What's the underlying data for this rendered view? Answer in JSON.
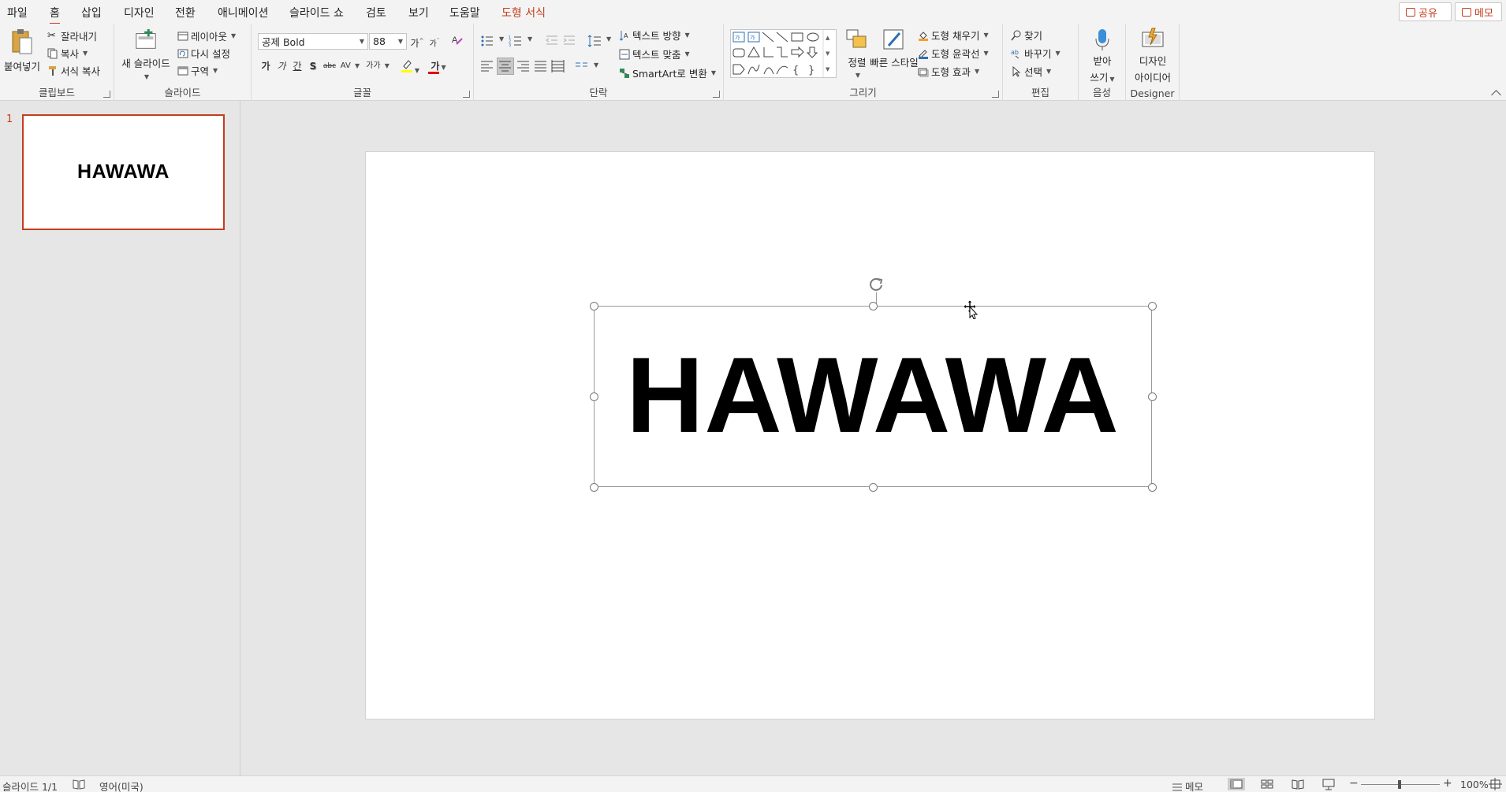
{
  "menu": {
    "tabs": [
      "파일",
      "홈",
      "삽입",
      "디자인",
      "전환",
      "애니메이션",
      "슬라이드 쇼",
      "검토",
      "보기",
      "도움말",
      "도형 서식"
    ],
    "active_tab": "홈",
    "context_tab": "도형 서식",
    "share_label": "공유",
    "comments_label": "메모"
  },
  "ribbon": {
    "clipboard": {
      "label": "클립보드",
      "paste": "붙여넣기",
      "cut": "잘라내기",
      "copy": "복사",
      "format_painter": "서식 복사"
    },
    "slides": {
      "label": "슬라이드",
      "new_slide": "새 슬라이드",
      "layout": "레이아웃",
      "reset": "다시 설정",
      "section": "구역"
    },
    "font": {
      "label": "글꼴",
      "font_name": "공제 Bold",
      "font_size": "88",
      "grow": "가",
      "shrink": "가",
      "bold": "가",
      "italic": "가",
      "underline": "간",
      "shadow": "S",
      "strike": "abc",
      "spacing": "AV",
      "case": "가가",
      "font_color_letter": "가",
      "highlight_color": "#ffff00",
      "font_color": "#e00000"
    },
    "paragraph": {
      "label": "단락",
      "text_direction": "텍스트 방향",
      "align_text": "텍스트 맞춤",
      "smartart": "SmartArt로 변환"
    },
    "drawing": {
      "label": "그리기",
      "arrange": "정렬",
      "quick_styles": "빠른 스타일",
      "shape_fill": "도형 채우기",
      "shape_outline": "도형 윤곽선",
      "shape_effects": "도형 효과"
    },
    "editing": {
      "label": "편집",
      "find": "찾기",
      "replace": "바꾸기",
      "select": "선택"
    },
    "voice": {
      "label": "음성",
      "dictate_line1": "받아",
      "dictate_line2": "쓰기"
    },
    "designer": {
      "label": "Designer",
      "ideas_line1": "디자인",
      "ideas_line2": "아이디어"
    }
  },
  "slides_panel": {
    "slide_number": "1",
    "thumbnail_text": "HAWAWA"
  },
  "slide": {
    "text": "HAWAWA"
  },
  "statusbar": {
    "slide_info": "슬라이드 1/1",
    "language": "영어(미국)",
    "notes": "메모",
    "zoom_out": "−",
    "zoom_in": "+",
    "zoom": "100%"
  },
  "colors": {
    "accent": "#c43e1c",
    "ribbon_bg": "#f3f3f3",
    "workspace_bg": "#e6e6e6"
  }
}
